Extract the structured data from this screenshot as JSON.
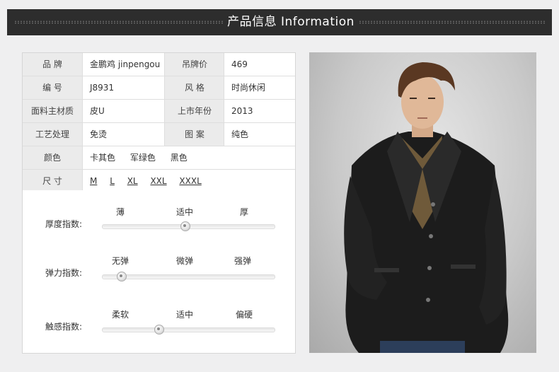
{
  "header": {
    "title": "产品信息 Information"
  },
  "specs": [
    {
      "label": "品 牌",
      "value": "金鹏鸡 jinpengou",
      "label2": "吊牌价",
      "value2": "469"
    },
    {
      "label": "编 号",
      "value": "J8931",
      "label2": "风 格",
      "value2": "时尚休闲"
    },
    {
      "label": "面料主材质",
      "value": "皮U",
      "label2": "上市年份",
      "value2": "2013"
    },
    {
      "label": "工艺处理",
      "value": "免烫",
      "label2": "图 案",
      "value2": "纯色"
    }
  ],
  "colors": {
    "label": "颜色",
    "options": [
      "卡其色",
      "军绿色",
      "黑色"
    ]
  },
  "sizes": {
    "label": "尺 寸",
    "options": [
      "M",
      "L",
      "XL",
      "XXL",
      "XXXL"
    ]
  },
  "indices": [
    {
      "name": "厚度指数:",
      "ticks": [
        "薄",
        "适中",
        "厚"
      ],
      "level": 0.48
    },
    {
      "name": "弹力指数:",
      "ticks": [
        "无弹",
        "微弹",
        "强弹"
      ],
      "level": 0.11
    },
    {
      "name": "触感指数:",
      "ticks": [
        "柔软",
        "适中",
        "偏硬"
      ],
      "level": 0.33
    }
  ],
  "photo": {
    "alt": "model wearing black leather jacket"
  }
}
